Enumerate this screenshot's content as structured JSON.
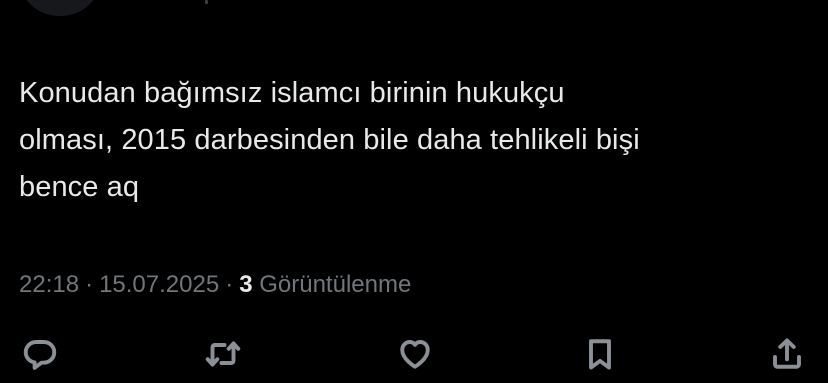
{
  "tweet": {
    "text_lines": [
      "Konudan bağımsız islamcı birinin hukukçu",
      "olması, 2015 darbesinden bile daha tehlikeli bişi",
      "bence aq"
    ],
    "time": "22:18",
    "separator": "·",
    "date": "15.07.2025",
    "views_count": "3",
    "views_label": "Görüntülenme"
  },
  "actions": [
    {
      "name": "reply",
      "icon": "reply-icon"
    },
    {
      "name": "retweet",
      "icon": "retweet-icon"
    },
    {
      "name": "like",
      "icon": "heart-icon"
    },
    {
      "name": "bookmark",
      "icon": "bookmark-icon"
    },
    {
      "name": "share",
      "icon": "share-icon"
    }
  ],
  "colors": {
    "background": "#000000",
    "text": "#e7e9ea",
    "secondary_text": "#71767b",
    "icon": "#8b9096"
  }
}
